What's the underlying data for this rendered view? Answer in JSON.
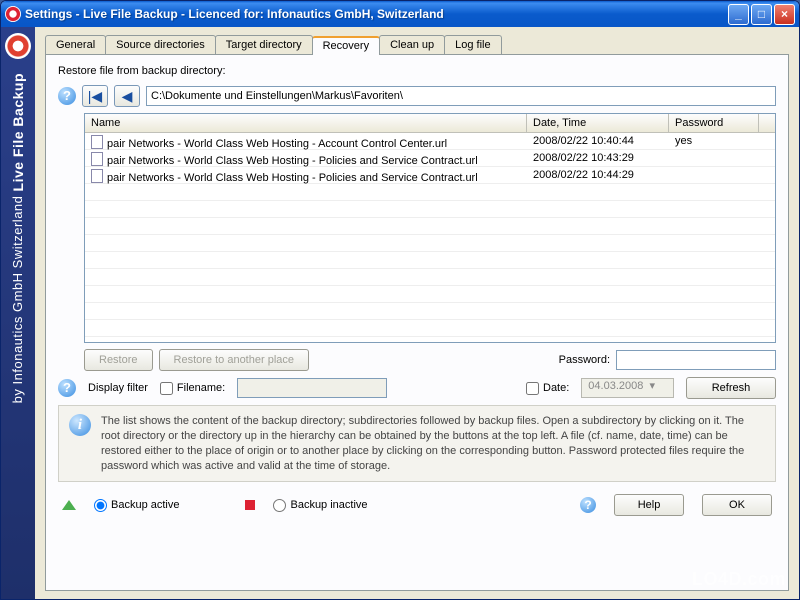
{
  "window": {
    "title": "Settings - Live File Backup - Licenced for: Infonautics GmbH, Switzerland"
  },
  "sidebar": {
    "company": "by Infonautics GmbH Switzerland",
    "product": "Live File Backup"
  },
  "tabs": [
    {
      "label": "General"
    },
    {
      "label": "Source directories"
    },
    {
      "label": "Target directory"
    },
    {
      "label": "Recovery"
    },
    {
      "label": "Clean up"
    },
    {
      "label": "Log file"
    }
  ],
  "recovery": {
    "heading": "Restore file from backup directory:",
    "path": "C:\\Dokumente und Einstellungen\\Markus\\Favoriten\\",
    "columns": {
      "name": "Name",
      "date": "Date, Time",
      "password": "Password"
    },
    "rows": [
      {
        "name": "pair Networks - World Class Web Hosting - Account Control Center.url",
        "date": "2008/02/22   10:40:44",
        "password": "yes"
      },
      {
        "name": "pair Networks - World Class Web Hosting - Policies and Service Contract.url",
        "date": "2008/02/22   10:43:29",
        "password": ""
      },
      {
        "name": "pair Networks - World Class Web Hosting - Policies and Service Contract.url",
        "date": "2008/02/22   10:44:29",
        "password": ""
      }
    ],
    "buttons": {
      "restore": "Restore",
      "restore_other": "Restore to another place",
      "refresh": "Refresh"
    },
    "password_label": "Password:",
    "filter": {
      "label": "Display filter",
      "filename_label": "Filename:",
      "filename_value": "",
      "date_label": "Date:",
      "date_value": "04.03.2008"
    },
    "info": "The list shows the content of the backup directory; subdirectories followed by backup files. Open a subdirectory by clicking on it. The root directory or the directory up in the hierarchy can be obtained by the buttons at the top left. A file (cf. name, date, time)  can be restored either to the place of origin or to another place by clicking on the corresponding button. Password protected files require the password which was active and valid at the time of storage."
  },
  "footer": {
    "backup_active": "Backup active",
    "backup_inactive": "Backup inactive",
    "help": "Help",
    "ok": "OK"
  },
  "watermark": "LO4D.com"
}
